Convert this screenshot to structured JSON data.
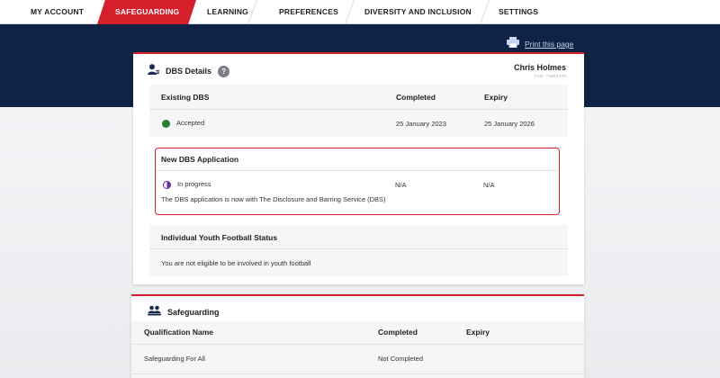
{
  "nav": {
    "tabs": [
      {
        "label": "MY ACCOUNT"
      },
      {
        "label": "SAFEGUARDING"
      },
      {
        "label": "LEARNING"
      },
      {
        "label": "PREFERENCES"
      },
      {
        "label": "DIVERSITY AND INCLUSION"
      },
      {
        "label": "SETTINGS"
      }
    ],
    "active_tab": "SAFEGUARDING"
  },
  "print": {
    "label": "Print this page",
    "icon": "printer-icon"
  },
  "dbs": {
    "title": "DBS Details",
    "help_label": "?",
    "user_name": "Chris Holmes",
    "user_sub": "FAN: 74851478",
    "existing": {
      "heading": "Existing DBS",
      "col_completed": "Completed",
      "col_expiry": "Expiry",
      "status": "Accepted",
      "completed": "25 January 2023",
      "expiry": "25 January 2026"
    },
    "new_application": {
      "heading": "New DBS Application",
      "status": "In progress",
      "completed": "N/A",
      "expiry": "N/A",
      "note": "The DBS application is now with The Disclosure and Barring Service (DBS)"
    },
    "youth": {
      "heading": "Individual Youth Football Status",
      "text": "You are not eligible to be involved in youth football"
    }
  },
  "safeguarding": {
    "title": "Safeguarding",
    "columns": [
      "Qualification Name",
      "Completed",
      "Expiry"
    ],
    "rows": [
      {
        "name": "Safeguarding For All",
        "completed": "Not Completed",
        "expiry": ""
      }
    ]
  },
  "colors": {
    "accent": "#d51f2b",
    "navy": "#0f2345",
    "accepted": "#2a7f2f",
    "in_progress": "#6a2fa3"
  }
}
